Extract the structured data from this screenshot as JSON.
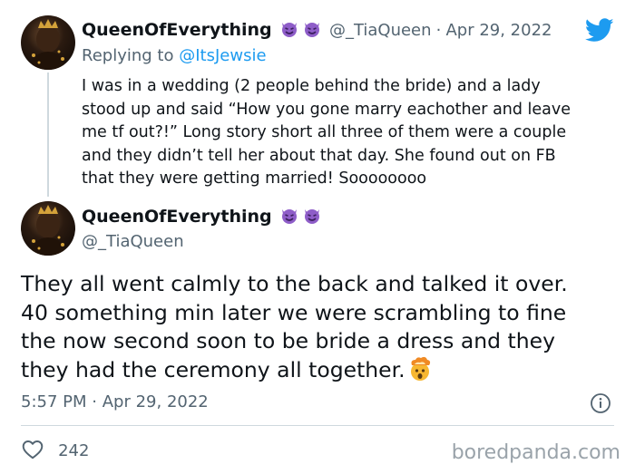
{
  "reply_tweet": {
    "display_name": "QueenOfEverything",
    "handle": "@_TiaQueen",
    "separator": "·",
    "date": "Apr 29, 2022",
    "replying_prefix": "Replying to",
    "replying_to": "@ItsJewsie",
    "lines": [
      "I was in a wedding (2 people behind the bride) and a lady",
      "stood up and said “How you gone marry eachother and leave",
      "me tf out?!” Long story short all three of them were a couple",
      "and they didn’t tell her about that day. She found out on FB",
      "that they were getting married! Soooooooo"
    ]
  },
  "main_tweet": {
    "display_name": "QueenOfEverything",
    "handle": "@_TiaQueen",
    "lines": [
      "They all went calmly to the back and talked it over.",
      "40 something min later we were scrambling to fine",
      "the now second soon to be bride a dress and they",
      "they had the ceremony all together."
    ],
    "time": "5:57 PM",
    "separator": "·",
    "date": "Apr 29, 2022",
    "likes": "242"
  },
  "icons": {
    "badge": "smiling-devil-emoji-icon",
    "mind_blown": "exploding-head-emoji-icon",
    "brand": "twitter-bird-icon",
    "info": "info-icon",
    "like": "heart-icon"
  },
  "colors": {
    "brand_blue": "#1d9bf0",
    "devil_purple": "#8e5dc8",
    "muted_text": "#536471"
  },
  "watermark": "boredpanda.com"
}
